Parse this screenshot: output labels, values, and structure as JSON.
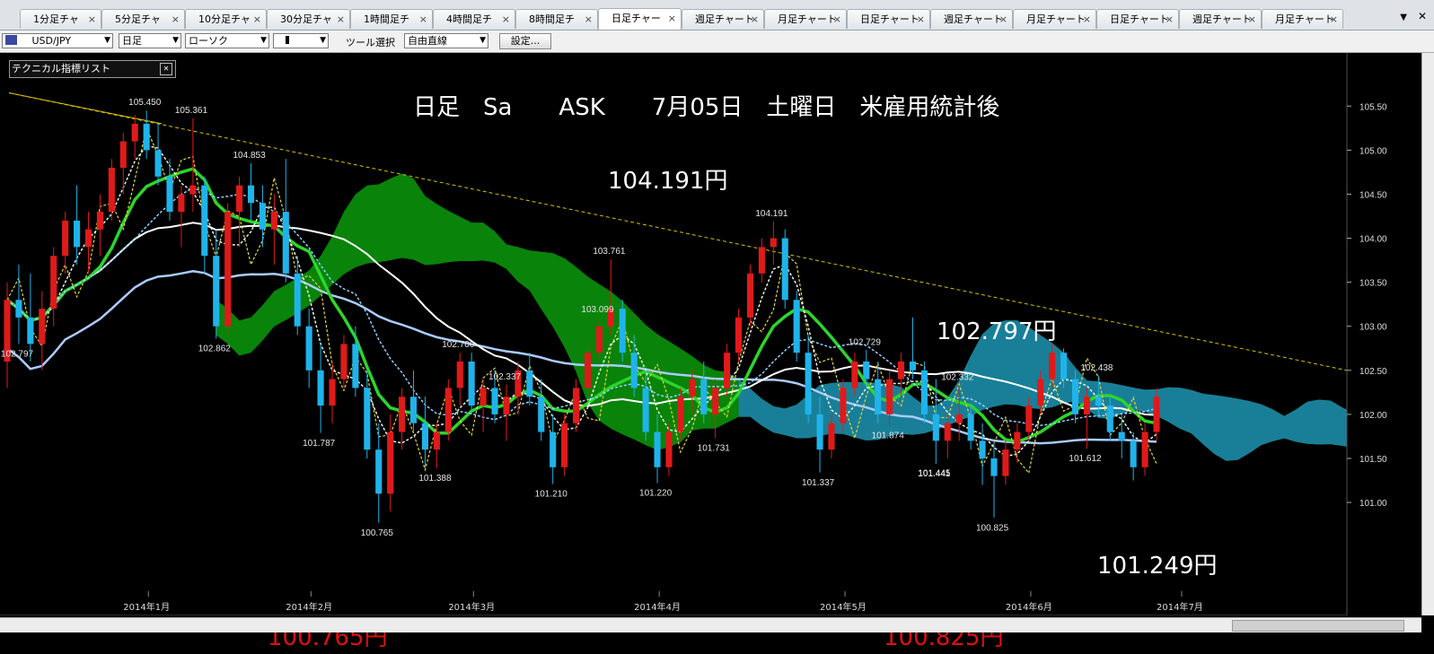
{
  "tabs": [
    {
      "label": "1分足チャ"
    },
    {
      "label": "5分足チャ"
    },
    {
      "label": "10分足チャ"
    },
    {
      "label": "30分足チャ"
    },
    {
      "label": "1時間足チ"
    },
    {
      "label": "4時間足チ"
    },
    {
      "label": "8時間足チ"
    },
    {
      "label": "日足チャー",
      "active": true
    },
    {
      "label": "週足チャート"
    },
    {
      "label": "月足チャート"
    },
    {
      "label": "日足チャート"
    },
    {
      "label": "週足チャート"
    },
    {
      "label": "月足チャート"
    },
    {
      "label": "日足チャート"
    },
    {
      "label": "週足チャート"
    },
    {
      "label": "月足チャート"
    }
  ],
  "toolbar": {
    "pair": "USD/JPY",
    "period": "日足",
    "chart_type": "ローソク",
    "tool_label": "ツール選択",
    "tool": "自由直線",
    "settings": "設定..."
  },
  "indicator_box": "テクニカル指標リスト",
  "annotations": {
    "title": "日足　Sa　　ASK　　7月05日　土曜日　米雇用統計後",
    "high1": "104.191円",
    "high2": "102.797円",
    "low1": "101.249円",
    "red1": "100.765円",
    "red2": "100.825円"
  },
  "colors": {
    "up": "#e01a1a",
    "down": "#1fb3ea",
    "cloud_bull": "#0a8a0a",
    "cloud_bear": "#1a7ea0",
    "ma_green": "#2bd62b",
    "ma_white": "#ffffff",
    "ma_lightblue": "#aaccff",
    "trend": "#d8c200"
  },
  "chart_data": {
    "type": "candlestick",
    "y_ticks": [
      "105.50",
      "105.00",
      "104.50",
      "104.00",
      "103.50",
      "103.00",
      "102.50",
      "102.00",
      "101.50",
      "101.00"
    ],
    "ylim": [
      100.4,
      105.9
    ],
    "x_labels": [
      "2014年1月",
      "2014年2月",
      "2014年3月",
      "2014年4月",
      "2014年5月",
      "2014年6月",
      "2014年7月"
    ],
    "price_labels": [
      {
        "text": "105.450"
      },
      {
        "text": "105.361"
      },
      {
        "text": "104.853"
      },
      {
        "text": "102.862"
      },
      {
        "text": "101.787"
      },
      {
        "text": "100.765"
      },
      {
        "text": "101.388"
      },
      {
        "text": "102.700"
      },
      {
        "text": "102.337"
      },
      {
        "text": "103.761"
      },
      {
        "text": "101.210"
      },
      {
        "text": "101.220"
      },
      {
        "text": "101.731"
      },
      {
        "text": "104.191"
      },
      {
        "text": "101.337"
      },
      {
        "text": "102.729"
      },
      {
        "text": "103.099"
      },
      {
        "text": "101.874"
      },
      {
        "text": "102.332"
      },
      {
        "text": "101.441"
      },
      {
        "text": "100.825"
      },
      {
        "text": "101.445"
      },
      {
        "text": "102.797"
      },
      {
        "text": "101.612"
      },
      {
        "text": "102.438"
      }
    ],
    "candles": [
      [
        102.6,
        103.5,
        102.3,
        103.3
      ],
      [
        103.3,
        103.7,
        102.8,
        103.1
      ],
      [
        103.1,
        103.6,
        102.6,
        102.8
      ],
      [
        102.8,
        103.4,
        102.5,
        103.2
      ],
      [
        103.2,
        103.9,
        103.0,
        103.8
      ],
      [
        103.8,
        104.3,
        103.6,
        104.2
      ],
      [
        104.2,
        104.6,
        103.7,
        103.9
      ],
      [
        103.9,
        104.3,
        103.6,
        104.1
      ],
      [
        104.1,
        104.5,
        103.8,
        104.3
      ],
      [
        104.3,
        104.9,
        104.2,
        104.8
      ],
      [
        104.8,
        105.2,
        104.5,
        105.1
      ],
      [
        105.1,
        105.4,
        104.9,
        105.3
      ],
      [
        105.3,
        105.45,
        104.9,
        105.0
      ],
      [
        105.0,
        105.3,
        104.6,
        104.7
      ],
      [
        104.7,
        104.9,
        104.2,
        104.3
      ],
      [
        104.3,
        104.6,
        103.9,
        104.5
      ],
      [
        104.5,
        105.36,
        104.3,
        104.6
      ],
      [
        104.6,
        104.7,
        103.6,
        103.8
      ],
      [
        103.8,
        104.1,
        102.86,
        103.0
      ],
      [
        103.0,
        104.4,
        102.9,
        104.3
      ],
      [
        104.3,
        104.7,
        103.9,
        104.6
      ],
      [
        104.6,
        104.85,
        104.2,
        104.4
      ],
      [
        104.4,
        104.6,
        103.9,
        104.1
      ],
      [
        104.1,
        104.5,
        103.7,
        104.3
      ],
      [
        104.3,
        104.9,
        103.5,
        103.6
      ],
      [
        103.6,
        103.8,
        102.9,
        103.0
      ],
      [
        103.0,
        103.2,
        102.3,
        102.5
      ],
      [
        102.5,
        102.8,
        101.79,
        102.1
      ],
      [
        102.1,
        102.6,
        101.9,
        102.4
      ],
      [
        102.4,
        102.9,
        102.3,
        102.8
      ],
      [
        102.8,
        103.0,
        102.2,
        102.3
      ],
      [
        102.3,
        102.5,
        101.5,
        101.6
      ],
      [
        101.6,
        101.9,
        100.77,
        101.1
      ],
      [
        101.1,
        102.0,
        100.9,
        101.8
      ],
      [
        101.8,
        102.3,
        101.6,
        102.2
      ],
      [
        102.2,
        102.5,
        101.8,
        101.9
      ],
      [
        101.9,
        102.2,
        101.4,
        101.6
      ],
      [
        101.6,
        101.9,
        101.39,
        101.8
      ],
      [
        101.8,
        102.4,
        101.7,
        102.3
      ],
      [
        102.3,
        102.7,
        102.1,
        102.6
      ],
      [
        102.6,
        102.7,
        102.0,
        102.1
      ],
      [
        102.1,
        102.4,
        101.8,
        102.3
      ],
      [
        102.3,
        102.5,
        101.9,
        102.0
      ],
      [
        102.0,
        102.34,
        101.7,
        102.2
      ],
      [
        102.2,
        102.6,
        102.0,
        102.5
      ],
      [
        102.5,
        102.7,
        102.1,
        102.2
      ],
      [
        102.2,
        102.4,
        101.7,
        101.8
      ],
      [
        101.8,
        102.0,
        101.21,
        101.4
      ],
      [
        101.4,
        102.0,
        101.3,
        101.9
      ],
      [
        101.9,
        102.4,
        101.8,
        102.3
      ],
      [
        102.3,
        102.8,
        102.2,
        102.7
      ],
      [
        102.7,
        103.1,
        102.6,
        103.0
      ],
      [
        103.0,
        103.76,
        102.9,
        103.2
      ],
      [
        103.2,
        103.3,
        102.6,
        102.7
      ],
      [
        102.7,
        102.9,
        102.2,
        102.3
      ],
      [
        102.3,
        102.5,
        101.7,
        101.8
      ],
      [
        101.8,
        102.0,
        101.22,
        101.4
      ],
      [
        101.4,
        101.9,
        101.3,
        101.8
      ],
      [
        101.8,
        102.3,
        101.7,
        102.2
      ],
      [
        102.2,
        102.5,
        102.0,
        102.4
      ],
      [
        102.4,
        102.6,
        101.9,
        102.0
      ],
      [
        102.0,
        102.4,
        101.73,
        102.3
      ],
      [
        102.3,
        102.8,
        102.2,
        102.7
      ],
      [
        102.7,
        103.2,
        102.6,
        103.1
      ],
      [
        103.1,
        103.7,
        103.0,
        103.6
      ],
      [
        103.6,
        104.0,
        103.5,
        103.9
      ],
      [
        103.9,
        104.19,
        103.7,
        104.0
      ],
      [
        104.0,
        104.1,
        103.2,
        103.3
      ],
      [
        103.3,
        103.4,
        102.6,
        102.7
      ],
      [
        102.7,
        102.9,
        101.9,
        102.0
      ],
      [
        102.0,
        102.2,
        101.34,
        101.6
      ],
      [
        101.6,
        102.0,
        101.5,
        101.9
      ],
      [
        101.9,
        102.4,
        101.8,
        102.3
      ],
      [
        102.3,
        102.7,
        102.2,
        102.6
      ],
      [
        102.6,
        102.73,
        102.3,
        102.4
      ],
      [
        102.4,
        102.6,
        101.9,
        102.0
      ],
      [
        102.0,
        102.5,
        101.87,
        102.4
      ],
      [
        102.4,
        102.7,
        102.2,
        102.6
      ],
      [
        102.6,
        103.1,
        102.4,
        102.5
      ],
      [
        102.5,
        102.6,
        101.9,
        102.0
      ],
      [
        102.0,
        102.4,
        101.44,
        101.7
      ],
      [
        101.7,
        102.0,
        101.5,
        101.9
      ],
      [
        101.9,
        102.33,
        101.7,
        102.0
      ],
      [
        102.0,
        102.1,
        101.6,
        101.7
      ],
      [
        101.7,
        101.9,
        101.2,
        101.5
      ],
      [
        101.5,
        101.7,
        100.83,
        101.3
      ],
      [
        101.3,
        101.7,
        101.2,
        101.6
      ],
      [
        101.6,
        101.9,
        101.45,
        101.8
      ],
      [
        101.8,
        102.2,
        101.7,
        102.1
      ],
      [
        102.1,
        102.5,
        102.0,
        102.4
      ],
      [
        102.4,
        102.8,
        102.3,
        102.7
      ],
      [
        102.7,
        102.75,
        102.3,
        102.4
      ],
      [
        102.4,
        102.5,
        101.9,
        102.0
      ],
      [
        102.0,
        102.3,
        101.61,
        102.2
      ],
      [
        102.2,
        102.44,
        102.0,
        102.1
      ],
      [
        102.1,
        102.2,
        101.7,
        101.8
      ],
      [
        101.8,
        102.0,
        101.5,
        101.7
      ],
      [
        101.7,
        101.8,
        101.25,
        101.4
      ],
      [
        101.4,
        101.9,
        101.3,
        101.8
      ],
      [
        101.8,
        102.3,
        101.7,
        102.2
      ]
    ]
  }
}
